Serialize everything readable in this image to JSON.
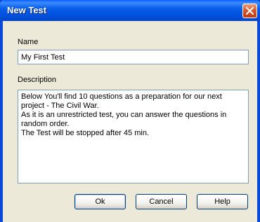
{
  "window": {
    "title": "New Test"
  },
  "form": {
    "name_label": "Name",
    "name_value": "My First Test",
    "description_label": "Description",
    "description_value": "Below You'll find 10 questions as a preparation for our next project - The Civil War.\nAs it is an unrestricted test, you can answer the questions in random order.\nThe Test will be stopped after 45 min."
  },
  "buttons": {
    "ok": "Ok",
    "cancel": "Cancel",
    "help": "Help"
  },
  "icons": {
    "close": "close-icon"
  },
  "colors": {
    "titlebar": "#0054e3",
    "window_bg": "#ece9d8",
    "close_button": "#d6582f",
    "input_border": "#7f9db9",
    "button_border": "#003c74"
  }
}
